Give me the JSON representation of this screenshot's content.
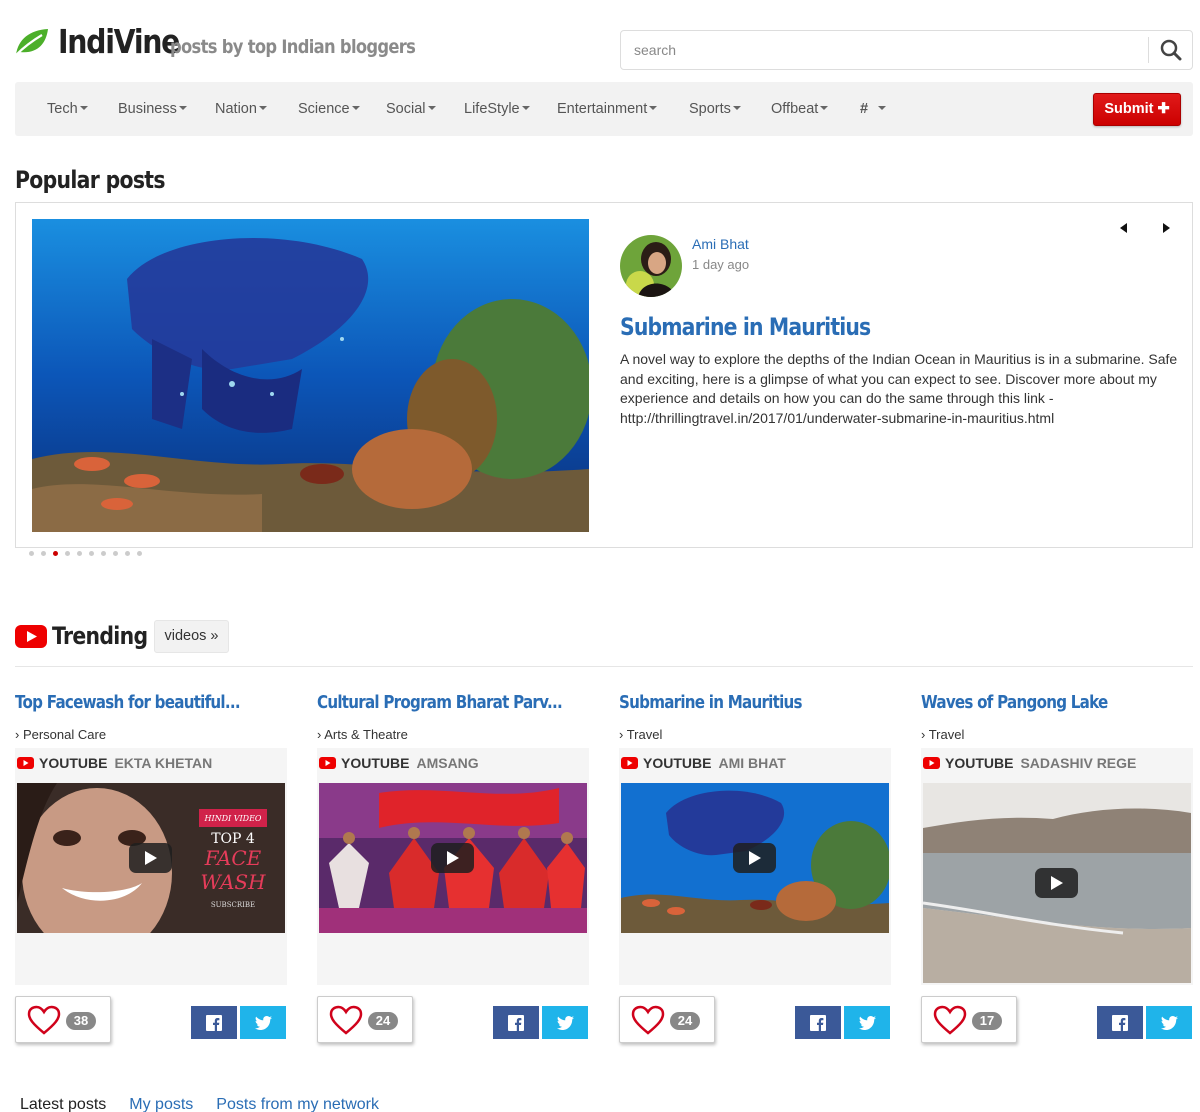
{
  "header": {
    "brand": "IndiVine",
    "tagline": "posts by top Indian bloggers",
    "search_placeholder": "search"
  },
  "nav": {
    "items": [
      "Tech",
      "Business",
      "Nation",
      "Science",
      "Social",
      "LifeStyle",
      "Entertainment",
      "Sports",
      "Offbeat",
      "#"
    ],
    "submit_label": "Submit ✚"
  },
  "popular": {
    "title": "Popular posts",
    "featured": {
      "author": "Ami Bhat",
      "time": "1 day ago",
      "title": "Submarine in Mauritius",
      "description": "A novel way to explore the depths of the Indian Ocean in Mauritius is in a submarine. Safe and exciting, here is a glimpse of what you can expect to see. Discover more about my experience and details on how you can do the same through this link - http://thrillingtravel.in/2017/01/underwater-submarine-in-mauritius.html"
    },
    "slide_count": 10,
    "active_slide": 3
  },
  "trending": {
    "title": "Trending",
    "videos_label": "videos »",
    "cards": [
      {
        "title": "Top Facewash for beautiful...",
        "category": "Personal Care",
        "source": "YOUTUBE",
        "channel": "EKTA KHETAN",
        "likes": "38",
        "thumb_text": [
          "HINDI VIDEO",
          "TOP 4",
          "FACE",
          "WASH",
          "SUBSCRIBE"
        ]
      },
      {
        "title": "Cultural Program Bharat Parv...",
        "category": "Arts & Theatre",
        "source": "YOUTUBE",
        "channel": "AMSANG",
        "likes": "24"
      },
      {
        "title": "Submarine in Mauritius",
        "category": "Travel",
        "source": "YOUTUBE",
        "channel": "AMI BHAT",
        "likes": "24"
      },
      {
        "title": "Waves of Pangong Lake",
        "category": "Travel",
        "source": "YOUTUBE",
        "channel": "SADASHIV REGE",
        "likes": "17"
      }
    ]
  },
  "tabs": {
    "latest": "Latest posts",
    "mine": "My posts",
    "network": "Posts from my network"
  },
  "colors": {
    "accent": "#2a6db5",
    "brand_green": "#4caf2a",
    "submit_red": "#cc0000",
    "facebook": "#3b5998",
    "twitter": "#1fb4ea"
  }
}
